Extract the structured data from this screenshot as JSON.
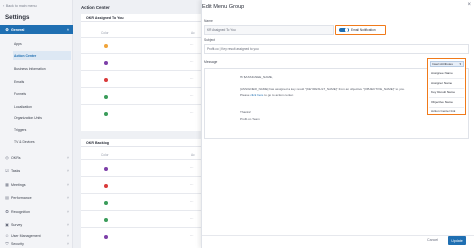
{
  "sidebar": {
    "back_label": "Back to main menu",
    "title": "Settings",
    "items": [
      {
        "label": "General",
        "icon": "gear-icon"
      },
      {
        "label": "OKRs",
        "icon": "target-icon"
      },
      {
        "label": "Tasks",
        "icon": "check-icon"
      },
      {
        "label": "Meetings",
        "icon": "calendar-icon"
      },
      {
        "label": "Performance",
        "icon": "chart-icon"
      },
      {
        "label": "Recognition",
        "icon": "award-icon"
      },
      {
        "label": "Survey",
        "icon": "survey-icon"
      },
      {
        "label": "User Management",
        "icon": "users-icon"
      },
      {
        "label": "Security",
        "icon": "shield-icon"
      }
    ],
    "sub_items": [
      {
        "label": "Apps"
      },
      {
        "label": "Action Center"
      },
      {
        "label": "Business Information"
      },
      {
        "label": "Emails"
      },
      {
        "label": "Funnels"
      },
      {
        "label": "Localization"
      },
      {
        "label": "Organization Units"
      },
      {
        "label": "Triggers"
      },
      {
        "label": "TV & Devices"
      }
    ]
  },
  "background_page": {
    "title": "Action Center",
    "sections": [
      {
        "header": "OKR Assigned To You",
        "col_color": "Color",
        "col_action": "Ac"
      },
      {
        "header": "OKR Backlog",
        "col_color": "Color",
        "col_action": "Ac"
      }
    ]
  },
  "modal": {
    "title": "Edit Menu Group",
    "name_label": "Name",
    "name_value": "KR Assigned To You",
    "toggle_label": "Email Notification",
    "subject_label": "Subject",
    "subject_value": "Profit.co | Key result assigned to you",
    "message_label": "Message",
    "insert_attributes_label": "Insert Attributes",
    "attribute_options": [
      "Assignee Name",
      "Assigner Name",
      "Key Result Name",
      "Objective Name",
      "Action Center link"
    ],
    "message_lines": [
      "Hi $ASSIGNEE_NAME,",
      "[ASSIGNER_NAME] has assigned a key result \"[KEYRESULT_NAME]\" from an objective \"[OBJECTIVE_NAME]\" to you.",
      "Please click here to go to action center.",
      "Thanks!",
      "Profit.co Team"
    ],
    "message_link_text": "click here",
    "cancel_label": "Cancel",
    "update_label": "Update"
  },
  "colors": {
    "accent": "#1f6fb2",
    "highlight": "#f07a1a",
    "row_dots": [
      "#f0a43a",
      "#7d3fa8",
      "#d93a3a",
      "#3a9c5a",
      "#3a9c5a",
      "#7d3fa8",
      "#d93a3a",
      "#3a9c5a",
      "#3a9c5a",
      "#7d3fa8"
    ]
  }
}
